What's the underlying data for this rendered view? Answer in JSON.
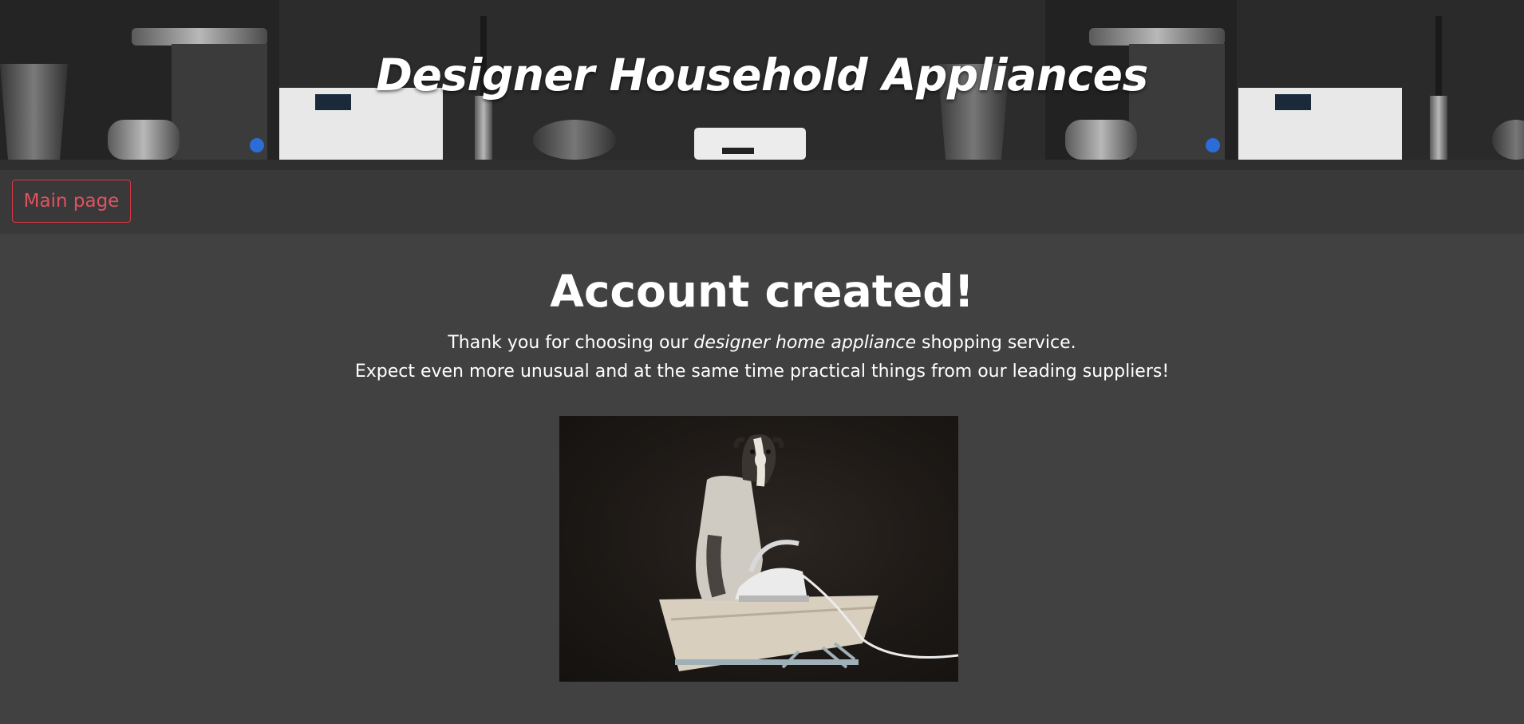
{
  "banner": {
    "title": "Designer Household Appliances",
    "background_icon": "kitchen-appliances-photo"
  },
  "nav": {
    "main_page_label": "Main page",
    "accent_color": "#dc3545"
  },
  "main": {
    "heading": "Account created!",
    "message_line1_before": "Thank you for choosing our ",
    "message_line1_emphasis": "designer home appliance",
    "message_line1_after": " shopping service.",
    "message_line2": "Expect even more unusual and at the same time practical things from our leading suppliers!",
    "photo_icon": "dog-ironing-photo"
  },
  "colors": {
    "page_background": "#414141",
    "navbar_background": "#393939",
    "text": "#ffffff"
  }
}
